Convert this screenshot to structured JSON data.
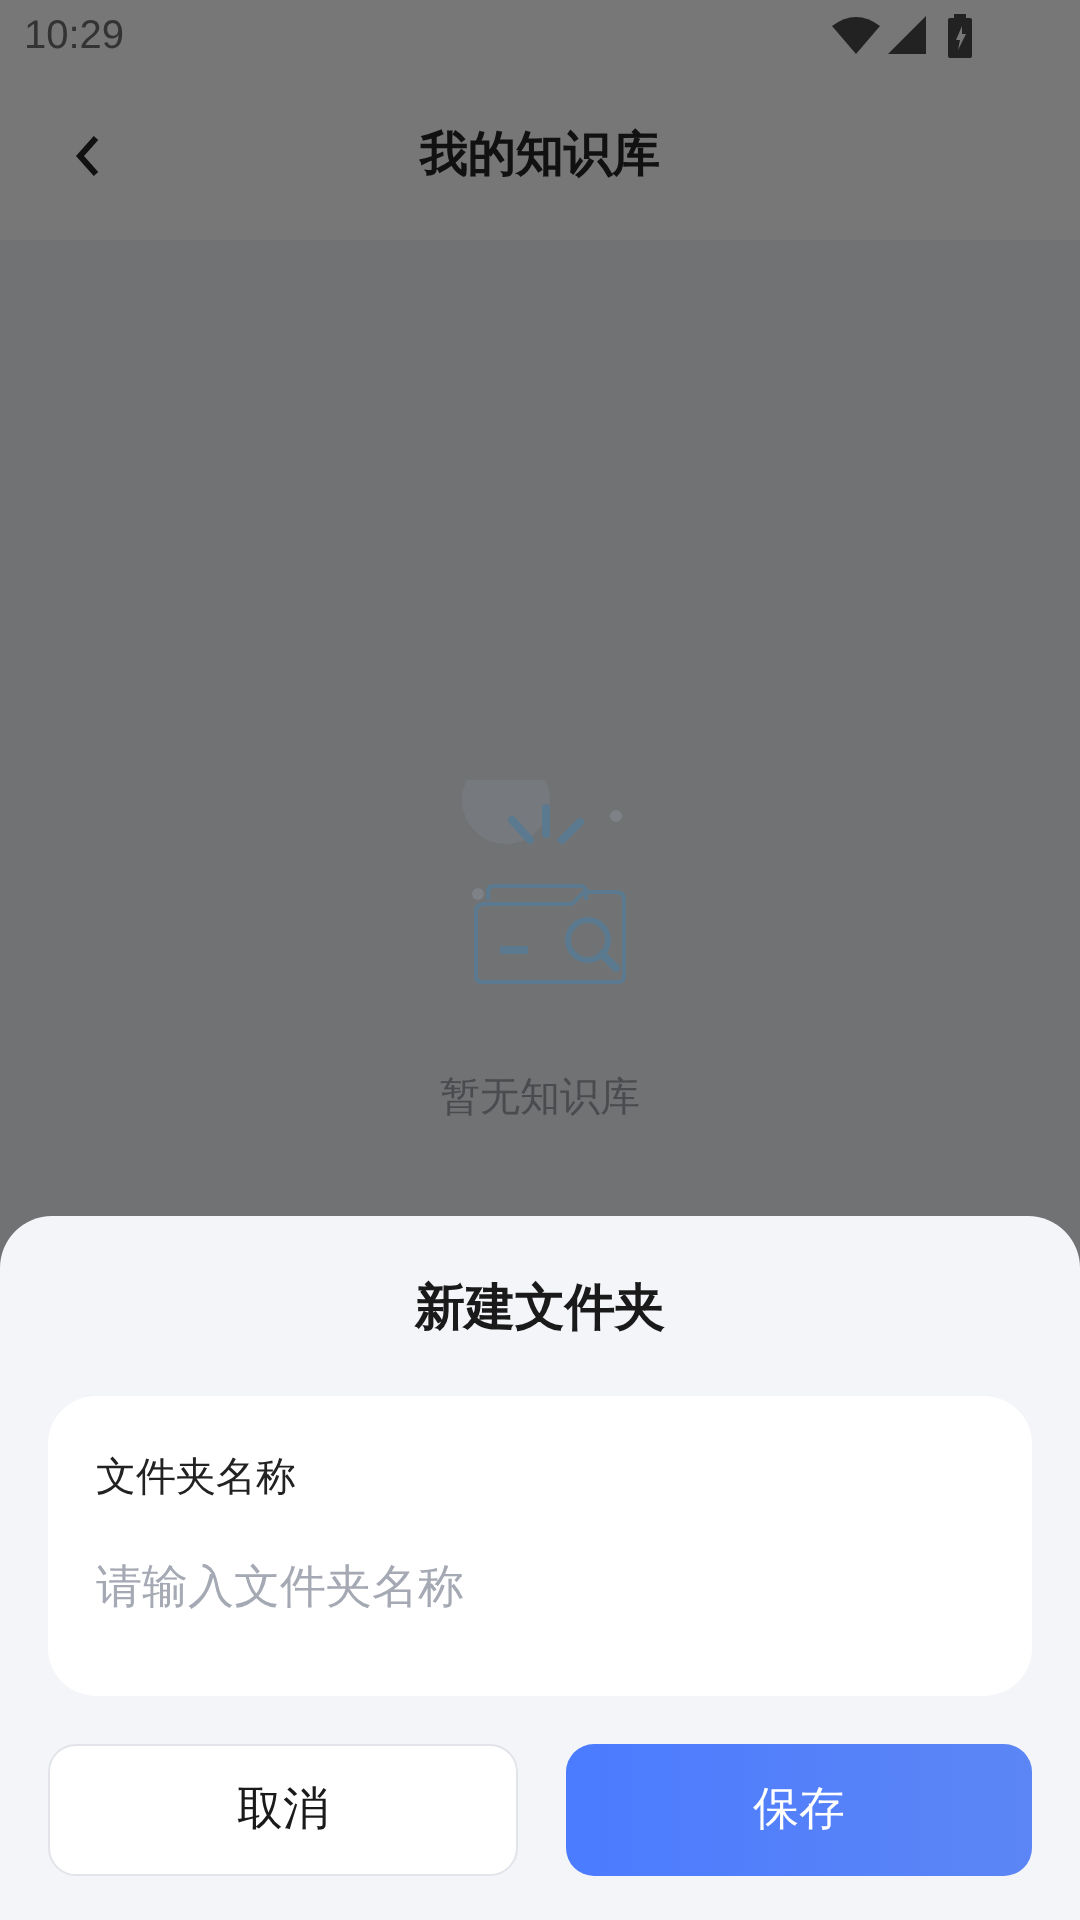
{
  "status_bar": {
    "time": "10:29"
  },
  "header": {
    "title": "我的知识库"
  },
  "empty_state": {
    "message": "暂无知识库"
  },
  "dialog": {
    "title": "新建文件夹",
    "field": {
      "label": "文件夹名称",
      "placeholder": "请输入文件夹名称"
    },
    "buttons": [
      {
        "label": "取消",
        "kind": "secondary"
      },
      {
        "label": "保存",
        "kind": "primary"
      }
    ]
  }
}
